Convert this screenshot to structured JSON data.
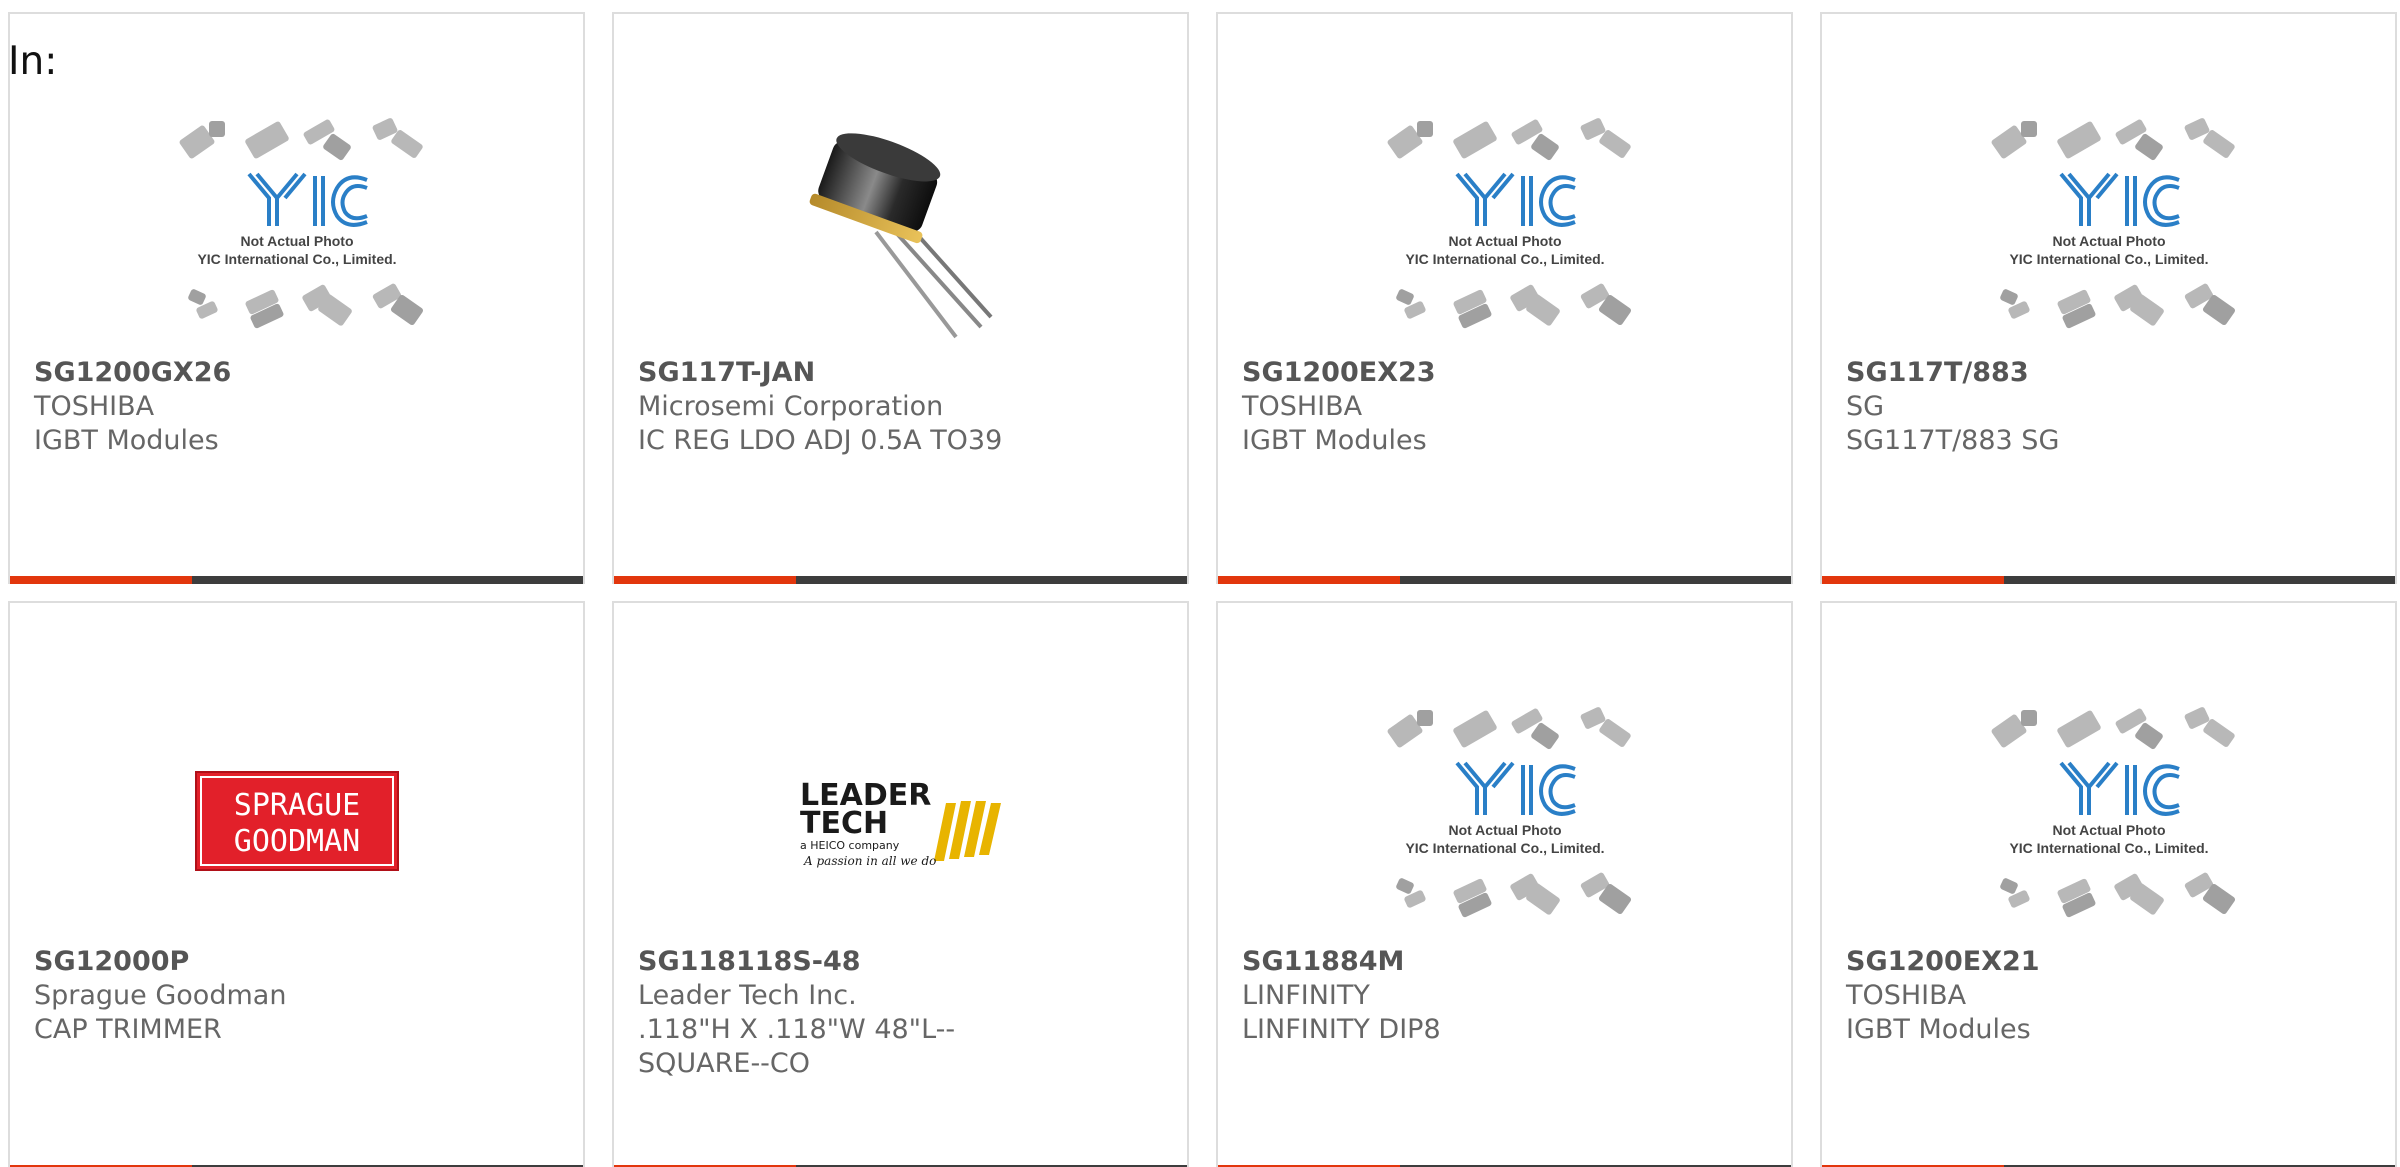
{
  "filter_label": "In:",
  "products": [
    {
      "part": "SG1200GX26",
      "maker": "TOSHIBA",
      "desc": "IGBT Modules",
      "image": "yic-placeholder",
      "placeholder_line1": "Not Actual Photo",
      "placeholder_line2": "YIC International Co., Limited."
    },
    {
      "part": "SG117T-JAN",
      "maker": "Microsemi Corporation",
      "desc": "IC REG LDO ADJ 0.5A TO39",
      "image": "to39-transistor-photo"
    },
    {
      "part": "SG1200EX23",
      "maker": "TOSHIBA",
      "desc": "IGBT Modules",
      "image": "yic-placeholder",
      "placeholder_line1": "Not Actual Photo",
      "placeholder_line2": "YIC International Co., Limited."
    },
    {
      "part": "SG117T/883",
      "maker": "SG",
      "desc": "SG117T/883 SG",
      "image": "yic-placeholder",
      "placeholder_line1": "Not Actual Photo",
      "placeholder_line2": "YIC International Co., Limited."
    },
    {
      "part": "SG12000P",
      "maker": "Sprague Goodman",
      "desc": "CAP TRIMMER",
      "image": "sprague-goodman-logo",
      "logo_line1": "SPRAGUE",
      "logo_line2": "GOODMAN"
    },
    {
      "part": "SG118118S-48",
      "maker": "Leader Tech Inc.",
      "desc": ".118\"H X .118\"W 48\"L--SQUARE--CO",
      "image": "leader-tech-logo",
      "logo_line1": "LEADER",
      "logo_line2": "TECH",
      "logo_line3": "a HEICO company",
      "logo_line4": "A passion in all we do"
    },
    {
      "part": "SG11884M",
      "maker": "LINFINITY",
      "desc": "LINFINITY DIP8",
      "image": "yic-placeholder",
      "placeholder_line1": "Not Actual Photo",
      "placeholder_line2": "YIC International Co., Limited."
    },
    {
      "part": "SG1200EX21",
      "maker": "TOSHIBA",
      "desc": "IGBT Modules",
      "image": "yic-placeholder",
      "placeholder_line1": "Not Actual Photo",
      "placeholder_line2": "YIC International Co., Limited."
    }
  ],
  "colors": {
    "accent": "#e2360d",
    "bar": "#3d3d3d",
    "card_border": "#dddddd",
    "yic_blue": "#2a7fc7",
    "sprague_red": "#e2202a",
    "leader_gold": "#e8b400"
  }
}
